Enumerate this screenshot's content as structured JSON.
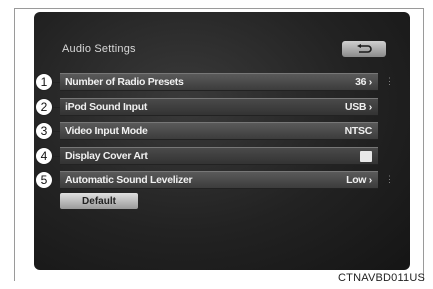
{
  "screen": {
    "title": "Audio Settings",
    "back_icon": "return-arrow-icon",
    "rows": [
      {
        "label": "Number of Radio Presets",
        "value": "36 ›",
        "callout": "1"
      },
      {
        "label": "iPod Sound Input",
        "value": "USB ›",
        "callout": "2"
      },
      {
        "label": "Video Input Mode",
        "value": "NTSC",
        "callout": "3"
      },
      {
        "label": "Display Cover Art",
        "value": "",
        "callout": "4"
      },
      {
        "label": "Automatic Sound Levelizer",
        "value": "Low ›",
        "callout": "5"
      }
    ],
    "default_label": "Default"
  },
  "figure_code": "CTNAVBD011US"
}
